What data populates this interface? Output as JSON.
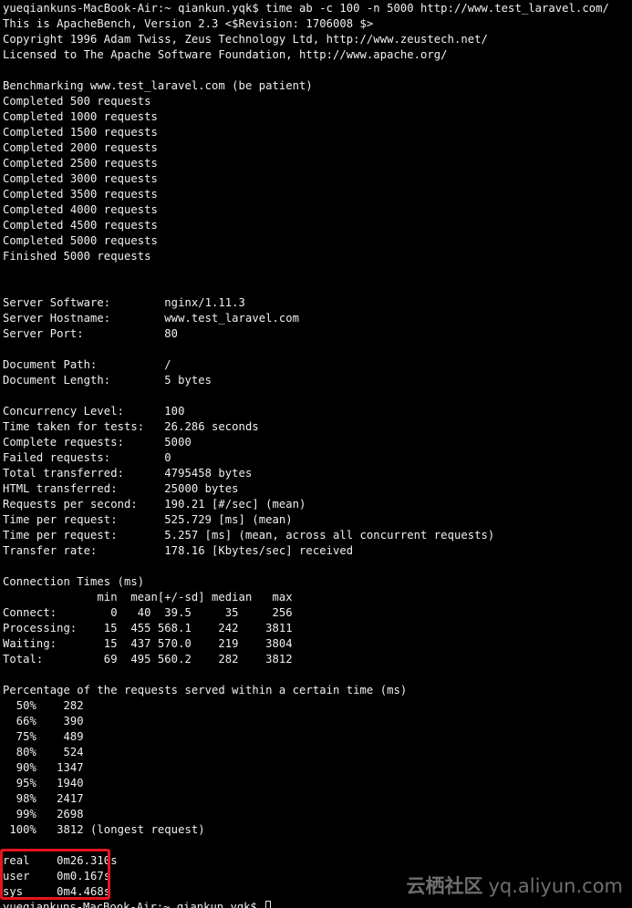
{
  "terminal": {
    "lines": [
      "yueqiankuns-MacBook-Air:~ qiankun.yqk$ time ab -c 100 -n 5000 http://www.test_laravel.com/",
      "This is ApacheBench, Version 2.3 <$Revision: 1706008 $>",
      "Copyright 1996 Adam Twiss, Zeus Technology Ltd, http://www.zeustech.net/",
      "Licensed to The Apache Software Foundation, http://www.apache.org/",
      "",
      "Benchmarking www.test_laravel.com (be patient)",
      "Completed 500 requests",
      "Completed 1000 requests",
      "Completed 1500 requests",
      "Completed 2000 requests",
      "Completed 2500 requests",
      "Completed 3000 requests",
      "Completed 3500 requests",
      "Completed 4000 requests",
      "Completed 4500 requests",
      "Completed 5000 requests",
      "Finished 5000 requests",
      "",
      "",
      "Server Software:        nginx/1.11.3",
      "Server Hostname:        www.test_laravel.com",
      "Server Port:            80",
      "",
      "Document Path:          /",
      "Document Length:        5 bytes",
      "",
      "Concurrency Level:      100",
      "Time taken for tests:   26.286 seconds",
      "Complete requests:      5000",
      "Failed requests:        0",
      "Total transferred:      4795458 bytes",
      "HTML transferred:       25000 bytes",
      "Requests per second:    190.21 [#/sec] (mean)",
      "Time per request:       525.729 [ms] (mean)",
      "Time per request:       5.257 [ms] (mean, across all concurrent requests)",
      "Transfer rate:          178.16 [Kbytes/sec] received",
      "",
      "Connection Times (ms)",
      "              min  mean[+/-sd] median   max",
      "Connect:        0   40  39.5     35     256",
      "Processing:    15  455 568.1    242    3811",
      "Waiting:       15  437 570.0    219    3804",
      "Total:         69  495 560.2    282    3812",
      "",
      "Percentage of the requests served within a certain time (ms)",
      "  50%    282",
      "  66%    390",
      "  75%    489",
      "  80%    524",
      "  90%   1347",
      "  95%   1940",
      "  98%   2417",
      "  99%   2698",
      " 100%   3812 (longest request)",
      "",
      "real    0m26.310s",
      "user    0m0.167s",
      "sys     0m4.468s"
    ],
    "prompt": "yueqiankuns-MacBook-Air:~ qiankun.yqk$ "
  },
  "watermark": {
    "brand_cn": "云栖社区",
    "domain": "yq.aliyun.com"
  }
}
